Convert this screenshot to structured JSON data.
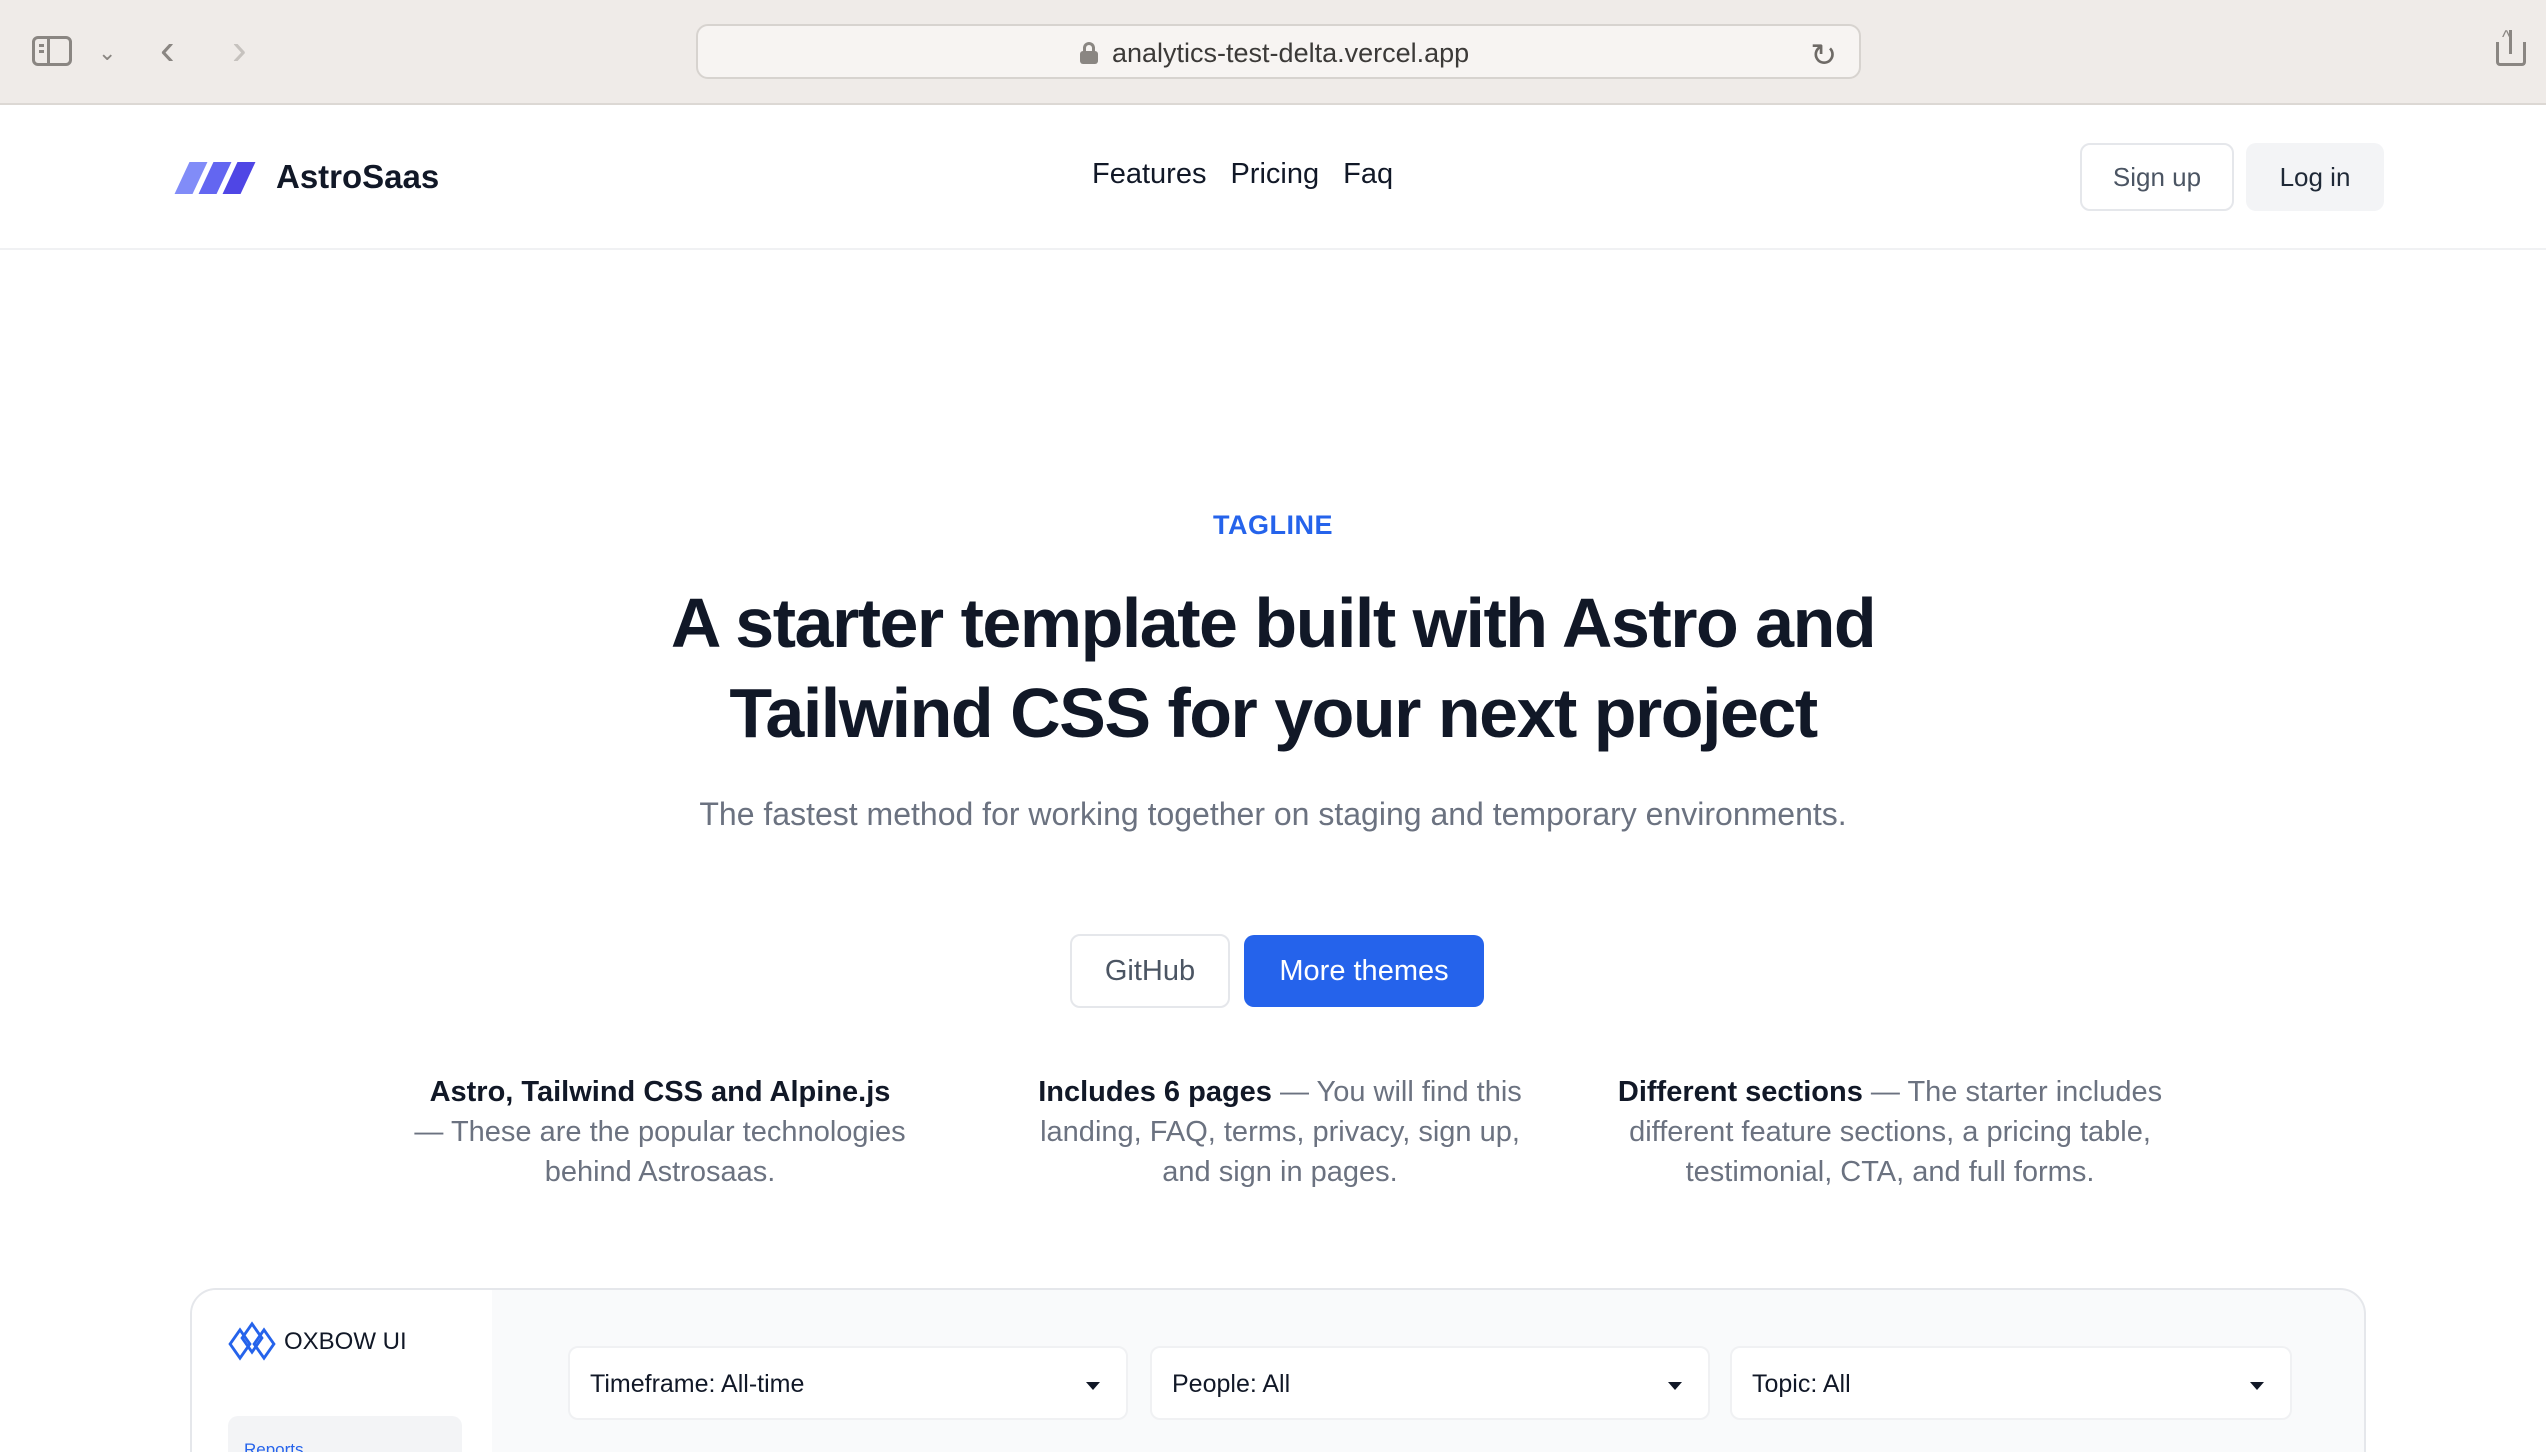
{
  "browser": {
    "url": "analytics-test-delta.vercel.app"
  },
  "header": {
    "brand": "AstroSaas",
    "nav": [
      "Features",
      "Pricing",
      "Faq"
    ],
    "signup_label": "Sign up",
    "login_label": "Log in"
  },
  "hero": {
    "tagline": "TAGLINE",
    "headline": "A starter template built with Astro and Tailwind CSS for your next project",
    "subheadline": "The fastest method for working together on staging and temporary environments.",
    "github_label": "GitHub",
    "themes_label": "More themes"
  },
  "features": [
    {
      "title": "Astro, Tailwind CSS and Alpine.js",
      "text": "These are the popular technologies behind Astrosaas."
    },
    {
      "title": "Includes 6 pages",
      "text": "You will find this landing, FAQ, terms, privacy, sign up, and sign in pages."
    },
    {
      "title": "Different sections",
      "text": "The starter includes different feature sections, a pricing table, testimonial, CTA, and full forms."
    }
  ],
  "preview": {
    "brand": "OXBOW UI",
    "side_item": "Reports",
    "filters": [
      "Timeframe: All-time",
      "People: All",
      "Topic: All"
    ]
  },
  "colors": {
    "accent": "#2563eb",
    "text": "#111827",
    "muted": "#6b7280"
  }
}
